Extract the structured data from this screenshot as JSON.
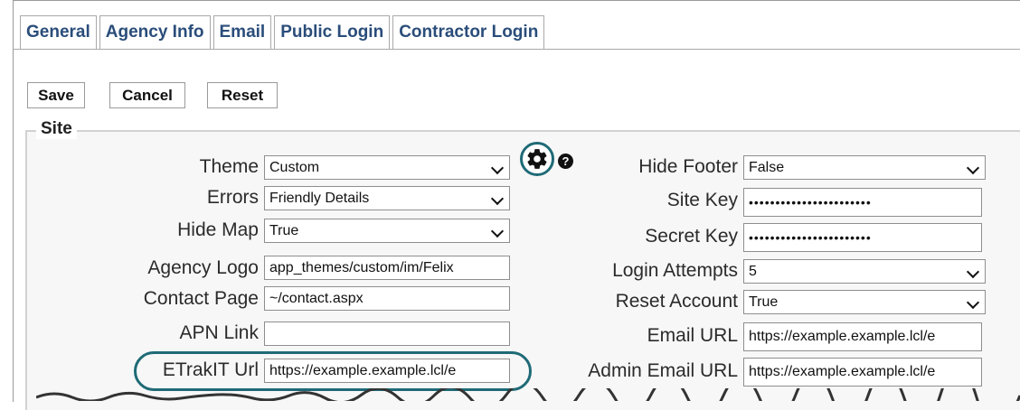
{
  "tabs": [
    {
      "label": "General"
    },
    {
      "label": "Agency Info"
    },
    {
      "label": "Email"
    },
    {
      "label": "Public Login"
    },
    {
      "label": "Contractor Login"
    }
  ],
  "toolbar": {
    "save_label": "Save",
    "cancel_label": "Cancel",
    "reset_label": "Reset"
  },
  "site": {
    "legend": "Site",
    "left": [
      {
        "label": "Theme",
        "value": "Custom",
        "kind": "select"
      },
      {
        "label": "Errors",
        "value": "Friendly Details",
        "kind": "select"
      },
      {
        "label": "Hide Map",
        "value": "True",
        "kind": "select"
      },
      {
        "label": "Agency Logo",
        "value": "app_themes/custom/im/Felix",
        "kind": "text"
      },
      {
        "label": "Contact Page",
        "value": "~/contact.aspx",
        "kind": "text"
      },
      {
        "label": "APN Link",
        "value": "",
        "kind": "text"
      },
      {
        "label": "ETrakIT Url",
        "value": "https://example.example.lcl/e",
        "kind": "text"
      }
    ],
    "right": [
      {
        "label": "Hide Footer",
        "value": "False",
        "kind": "select"
      },
      {
        "label": "Site Key",
        "value": "•••••••••••••••••••••••",
        "kind": "password"
      },
      {
        "label": "Secret Key",
        "value": "•••••••••••••••••••••••",
        "kind": "password"
      },
      {
        "label": "Login Attempts",
        "value": "5",
        "kind": "select"
      },
      {
        "label": "Reset Account",
        "value": "True",
        "kind": "select"
      },
      {
        "label": "Email URL",
        "value": "https://example.example.lcl/e",
        "kind": "text"
      },
      {
        "label": "Admin Email URL",
        "value": "https://example.example.lcl/e",
        "kind": "text"
      }
    ]
  },
  "icons": {
    "settings": "gear-icon",
    "help": "help-icon",
    "help_glyph": "?"
  },
  "colors": {
    "tab_text": "#2a4d7a",
    "highlight_ring": "#1f6a76"
  }
}
